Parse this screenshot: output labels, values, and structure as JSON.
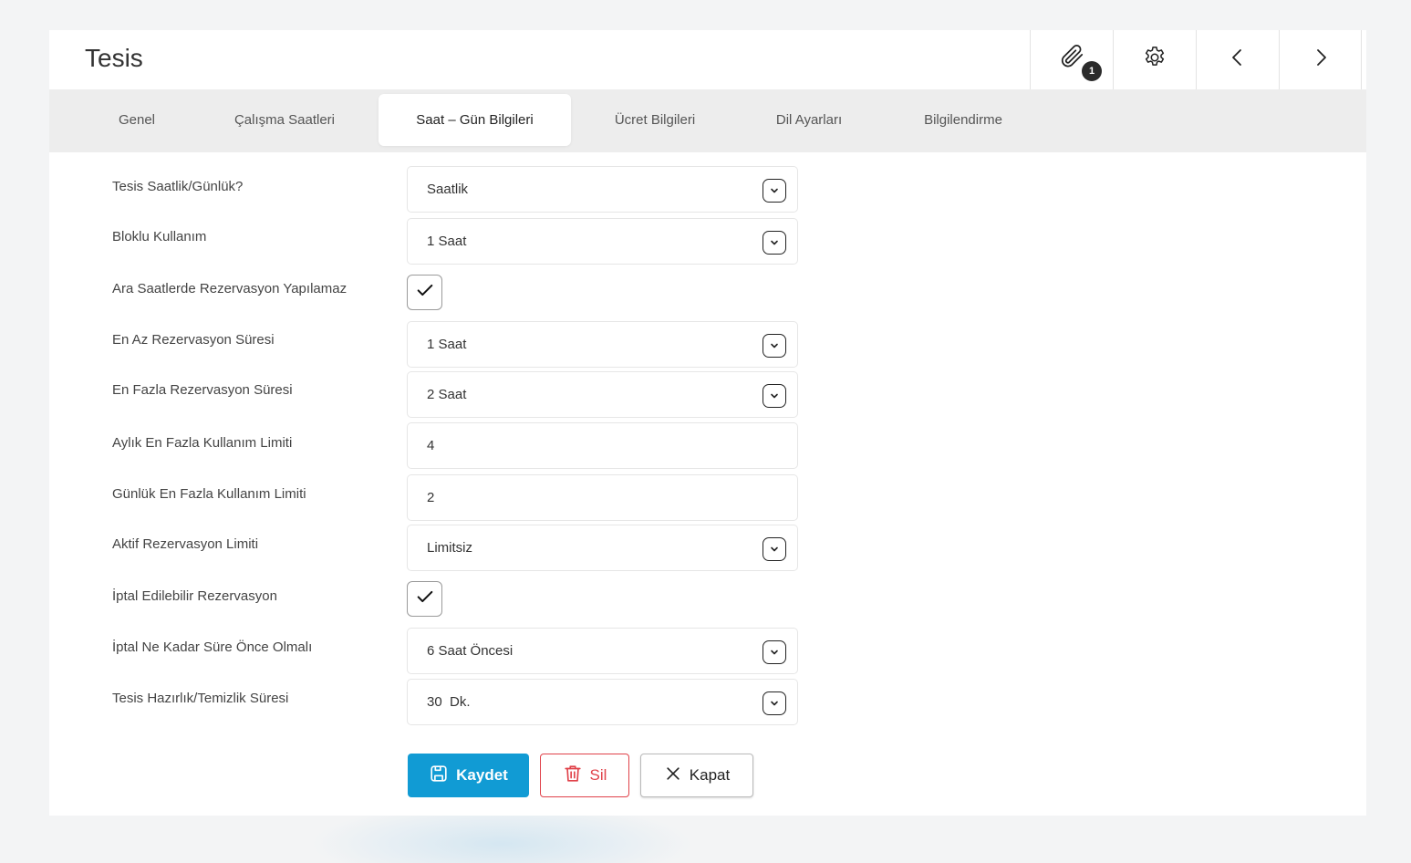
{
  "header": {
    "title": "Tesis",
    "attachment_count": "1"
  },
  "tabs": [
    {
      "label": "Genel"
    },
    {
      "label": "Çalışma Saatleri"
    },
    {
      "label": "Saat – Gün Bilgileri"
    },
    {
      "label": "Ücret Bilgileri"
    },
    {
      "label": "Dil Ayarları"
    },
    {
      "label": "Bilgilendirme"
    }
  ],
  "active_tab": "Saat – Gün Bilgileri",
  "form": {
    "rows": [
      {
        "label": "Tesis Saatlik/Günlük?",
        "type": "select",
        "value": "Saatlik"
      },
      {
        "label": "Bloklu Kullanım",
        "type": "select",
        "value": "1 Saat"
      },
      {
        "label": "Ara Saatlerde Rezervasyon Yapılamaz",
        "type": "checkbox",
        "checked": true
      },
      {
        "label": "En Az Rezervasyon Süresi",
        "type": "select",
        "value": "1 Saat"
      },
      {
        "label": "En Fazla Rezervasyon Süresi",
        "type": "select",
        "value": "2 Saat"
      },
      {
        "label": "Aylık En Fazla Kullanım Limiti",
        "type": "input",
        "value": "4"
      },
      {
        "label": "Günlük En Fazla Kullanım Limiti",
        "type": "input",
        "value": "2"
      },
      {
        "label": "Aktif Rezervasyon Limiti",
        "type": "select",
        "value": "Limitsiz"
      },
      {
        "label": "İptal Edilebilir Rezervasyon",
        "type": "checkbox",
        "checked": true
      },
      {
        "label": "İptal Ne Kadar Süre Önce Olmalı",
        "type": "select",
        "value": "6 Saat Öncesi"
      },
      {
        "label": "Tesis Hazırlık/Temizlik Süresi",
        "type": "select",
        "value": "30  Dk."
      }
    ]
  },
  "actions": {
    "save_label": "Kaydet",
    "delete_label": "Sil",
    "close_label": "Kapat"
  },
  "colors": {
    "save": "#119bd4",
    "delete": "#e0424a"
  },
  "icons": [
    "paperclip-icon",
    "gear-icon",
    "chevron-left-icon",
    "chevron-right-icon",
    "chevron-down-icon",
    "check-icon",
    "save-icon",
    "trash-icon",
    "close-icon"
  ]
}
